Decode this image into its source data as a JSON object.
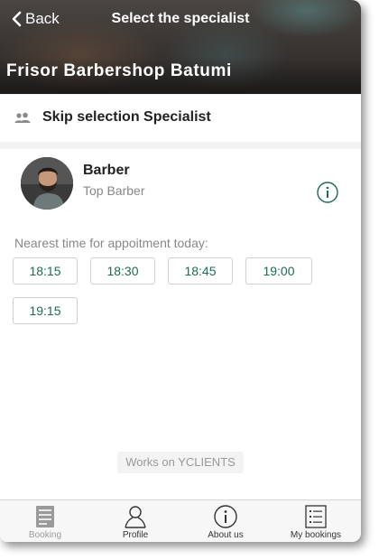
{
  "header": {
    "back_label": "Back",
    "title": "Select the specialist",
    "company_name": "Frisor Barbershop Batumi"
  },
  "skip": {
    "label": "Skip selection Specialist",
    "icon": "users-icon"
  },
  "specialist": {
    "name": "Barber",
    "role": "Top Barber",
    "info_icon": "info-icon"
  },
  "nearest": {
    "label": "Nearest time for appoitment today:",
    "slots": [
      "18:15",
      "18:30",
      "18:45",
      "19:00",
      "19:15"
    ]
  },
  "footer_note": "Works on YCLIENTS",
  "tabs": [
    {
      "label": "Booking",
      "icon": "booking-icon",
      "active": true
    },
    {
      "label": "Profile",
      "icon": "profile-icon",
      "active": false
    },
    {
      "label": "About us",
      "icon": "info-icon",
      "active": false
    },
    {
      "label": "My bookings",
      "icon": "list-icon",
      "active": false
    }
  ],
  "colors": {
    "accent": "#1e6b52",
    "muted_text": "#888888",
    "background": "#f3f3f3"
  }
}
